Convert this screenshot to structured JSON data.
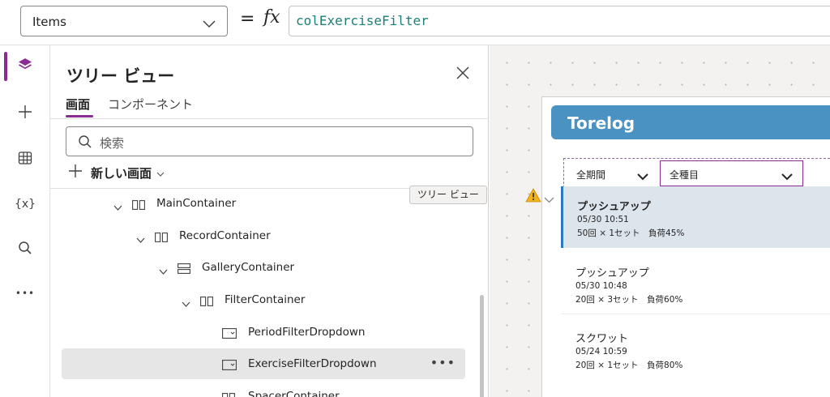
{
  "formula_bar": {
    "property": "Items",
    "equals": "=",
    "fx": "fx",
    "formula": "colExerciseFilter"
  },
  "rail": {
    "items": [
      {
        "icon": "layers-icon",
        "active": true
      },
      {
        "icon": "plus-icon"
      },
      {
        "icon": "table-icon"
      },
      {
        "icon": "variables-icon",
        "label": "{x}"
      },
      {
        "icon": "search-icon"
      },
      {
        "icon": "more-icon",
        "label": "•••"
      }
    ]
  },
  "panel": {
    "title": "ツリー ビュー",
    "tabs": [
      "画面",
      "コンポーネント"
    ],
    "search_placeholder": "検索",
    "new_screen_label": "新しい画面",
    "tooltip": "ツリー ビュー",
    "tree": [
      {
        "label": "MainContainer",
        "icon": "horizontal-container-icon",
        "expanded": true
      },
      {
        "label": "RecordContainer",
        "icon": "horizontal-container-icon",
        "expanded": true
      },
      {
        "label": "GalleryContainer",
        "icon": "vertical-container-icon",
        "expanded": true
      },
      {
        "label": "FilterContainer",
        "icon": "horizontal-container-icon",
        "expanded": true
      },
      {
        "label": "PeriodFilterDropdown",
        "icon": "dropdown-control-icon"
      },
      {
        "label": "ExerciseFilterDropdown",
        "icon": "dropdown-control-icon",
        "selected": true,
        "more": "•••"
      },
      {
        "label": "SpacerContainer",
        "icon": "horizontal-container-icon"
      }
    ]
  },
  "app": {
    "header_title": "Torelog",
    "period_filter": "全期間",
    "exercise_filter": "全種目",
    "header_color": "#4a92c2",
    "items": [
      {
        "name": "プッシュアップ",
        "date": "05/30 10:51",
        "detail": "50回 × 1セット　負荷45%",
        "selected": true
      },
      {
        "name": "プッシュアップ",
        "date": "05/30 10:48",
        "detail": "20回 × 3セット　負荷60%"
      },
      {
        "name": "スクワット",
        "date": "05/24 10:59",
        "detail": "20回 × 1セット　負荷80%"
      }
    ]
  },
  "colors": {
    "accent": "#8a2d93",
    "formula_text": "#1a7f76",
    "selection_bar": "#2b79c2",
    "warning": "#f2b31b"
  }
}
